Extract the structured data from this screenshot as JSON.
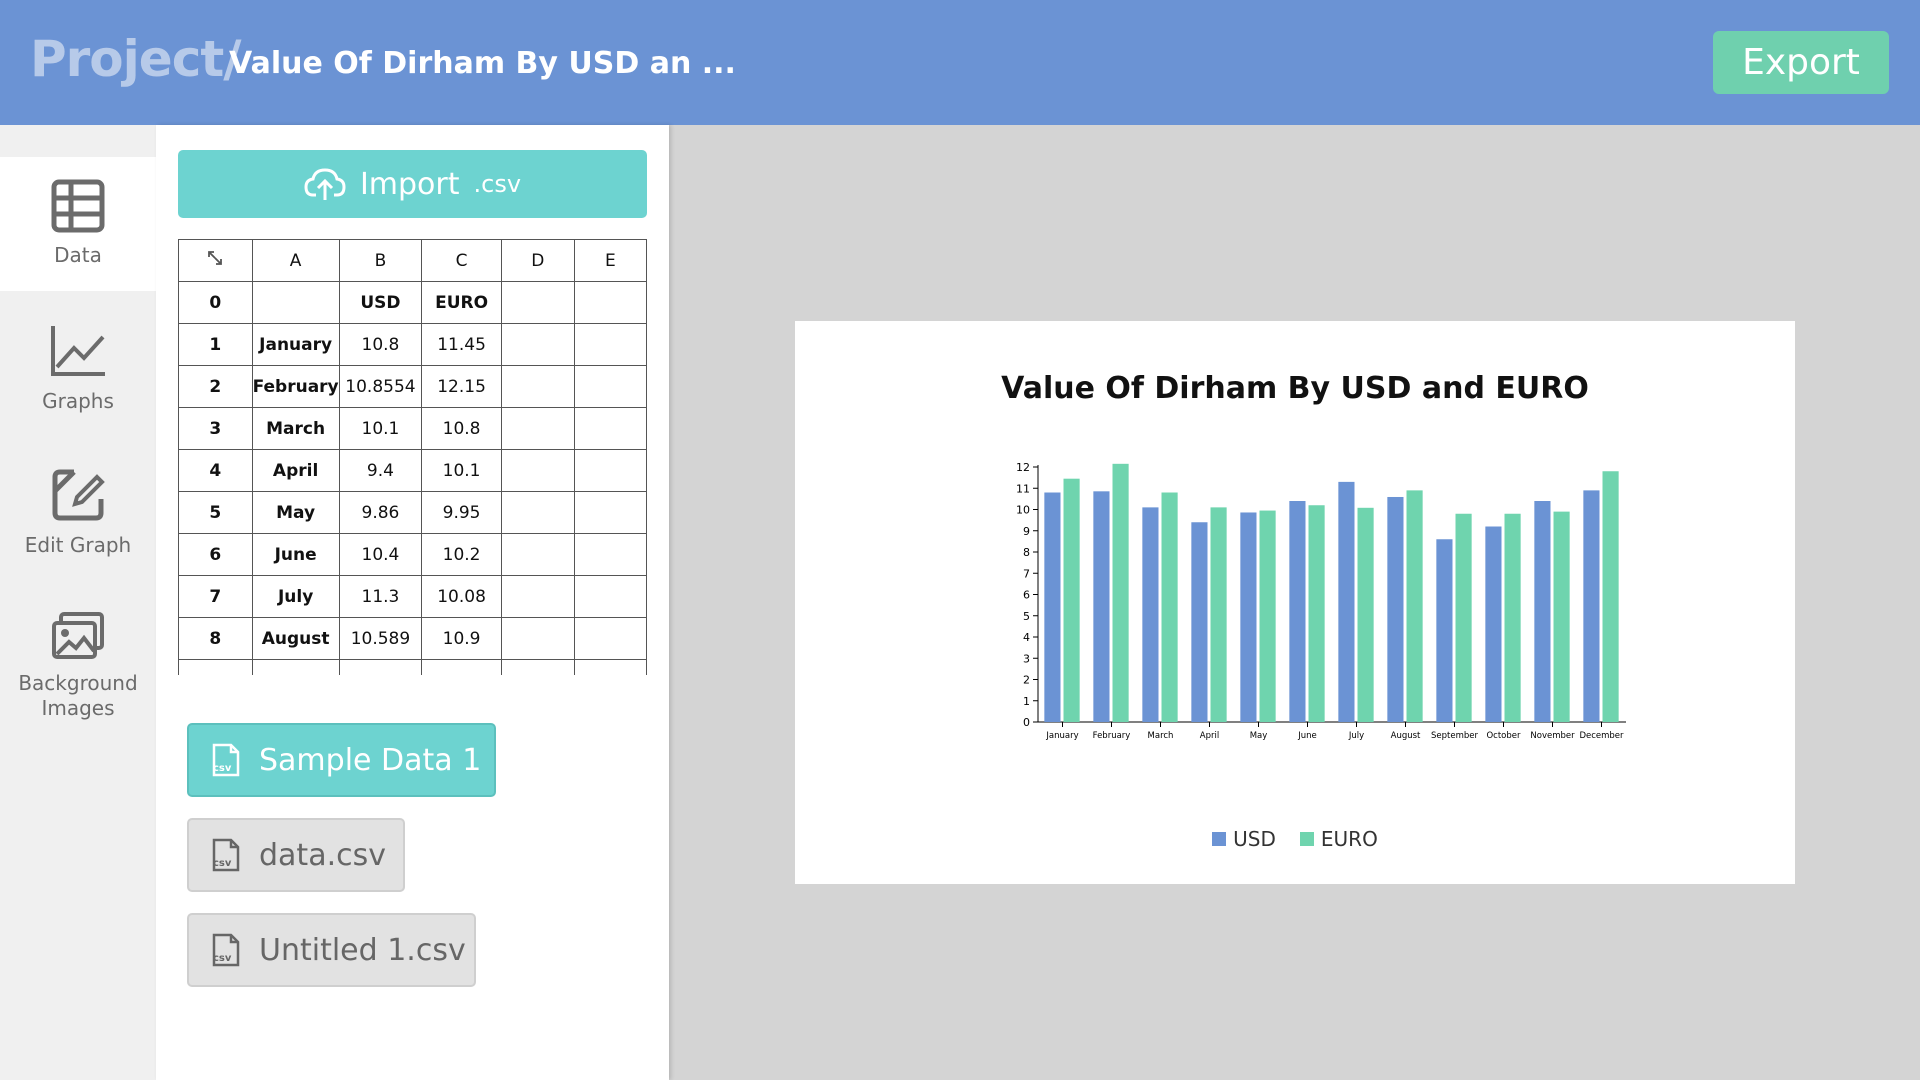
{
  "header": {
    "brand": "Project/",
    "title": "Value Of Dirham By USD an ...",
    "export_label": "Export"
  },
  "rail": {
    "items": [
      {
        "label": "Data",
        "icon": "table-icon",
        "active": true
      },
      {
        "label": "Graphs",
        "icon": "line-chart-icon",
        "active": false
      },
      {
        "label": "Edit Graph",
        "icon": "edit-icon",
        "active": false
      },
      {
        "label": "Background Images",
        "icon": "images-icon",
        "active": false
      }
    ]
  },
  "panel": {
    "import_label": "Import",
    "import_ext": ".csv",
    "grid": {
      "columns": [
        "A",
        "B",
        "C",
        "D",
        "E"
      ],
      "rows": [
        {
          "idx": "0",
          "cells": [
            "",
            "USD",
            "EURO",
            "",
            ""
          ]
        },
        {
          "idx": "1",
          "cells": [
            "January",
            "10.8",
            "11.45",
            "",
            ""
          ]
        },
        {
          "idx": "2",
          "cells": [
            "February",
            "10.8554",
            "12.15",
            "",
            ""
          ]
        },
        {
          "idx": "3",
          "cells": [
            "March",
            "10.1",
            "10.8",
            "",
            ""
          ]
        },
        {
          "idx": "4",
          "cells": [
            "April",
            "9.4",
            "10.1",
            "",
            ""
          ]
        },
        {
          "idx": "5",
          "cells": [
            "May",
            "9.86",
            "9.95",
            "",
            ""
          ]
        },
        {
          "idx": "6",
          "cells": [
            "June",
            "10.4",
            "10.2",
            "",
            ""
          ]
        },
        {
          "idx": "7",
          "cells": [
            "July",
            "11.3",
            "10.08",
            "",
            ""
          ]
        },
        {
          "idx": "8",
          "cells": [
            "August",
            "10.589",
            "10.9",
            "",
            ""
          ]
        },
        {
          "idx": "",
          "cells": [
            "",
            "",
            "",
            "",
            ""
          ]
        }
      ]
    },
    "files": [
      {
        "label": "Sample Data 1",
        "selected": true
      },
      {
        "label": "data.csv",
        "selected": false
      },
      {
        "label": "Untitled 1.csv",
        "selected": false
      }
    ]
  },
  "colors": {
    "usd": "#6b93d4",
    "euro": "#6fd4ae",
    "header": "#6b93d4",
    "accent": "#6dd3d0"
  },
  "chart_data": {
    "type": "bar",
    "title": "Value Of Dirham By USD and EURO",
    "categories": [
      "January",
      "February",
      "March",
      "April",
      "May",
      "June",
      "July",
      "August",
      "September",
      "October",
      "November",
      "December"
    ],
    "series": [
      {
        "name": "USD",
        "values": [
          10.8,
          10.8554,
          10.1,
          9.4,
          9.86,
          10.4,
          11.3,
          10.589,
          8.6,
          9.2,
          10.4,
          10.9
        ]
      },
      {
        "name": "EURO",
        "values": [
          11.45,
          12.15,
          10.8,
          10.1,
          9.95,
          10.2,
          10.08,
          10.9,
          9.8,
          9.8,
          9.9,
          11.8
        ]
      }
    ],
    "yticks": [
      "0",
      "1",
      "2",
      "3",
      "4",
      "5",
      "6",
      "7",
      "8",
      "9",
      "10",
      "11",
      "12"
    ],
    "ylim": [
      0,
      12
    ],
    "legend": "bottom"
  }
}
